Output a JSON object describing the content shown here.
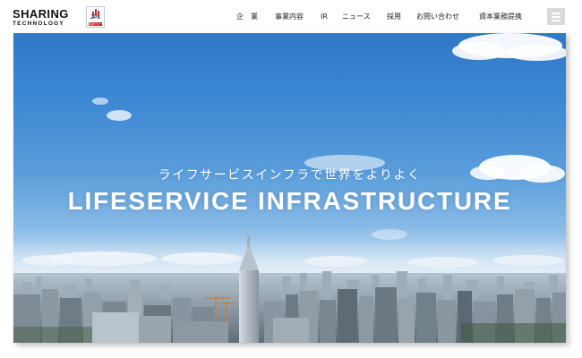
{
  "brand": {
    "logo_main": "SHARING",
    "logo_sub": "TECHNOLOGY",
    "badge_text": "JPX",
    "badge_strip": "東証グロース上場",
    "badge_color": "#c0272d"
  },
  "nav": {
    "items": [
      {
        "label": "企　業"
      },
      {
        "label": "事業内容"
      },
      {
        "label": "IR"
      },
      {
        "label": "ニュース"
      },
      {
        "label": "採用"
      },
      {
        "label": "お問い合わせ"
      },
      {
        "label": "資本業務提携"
      }
    ],
    "menu_icon": "hamburger-menu-icon"
  },
  "hero": {
    "subtitle": "ライフサービスインフラで世界をよりよく",
    "title": "LIFESERVICE INFRASTRUCTURE",
    "image": "city-skyline-photo",
    "sky_color": "#3b86d2"
  }
}
